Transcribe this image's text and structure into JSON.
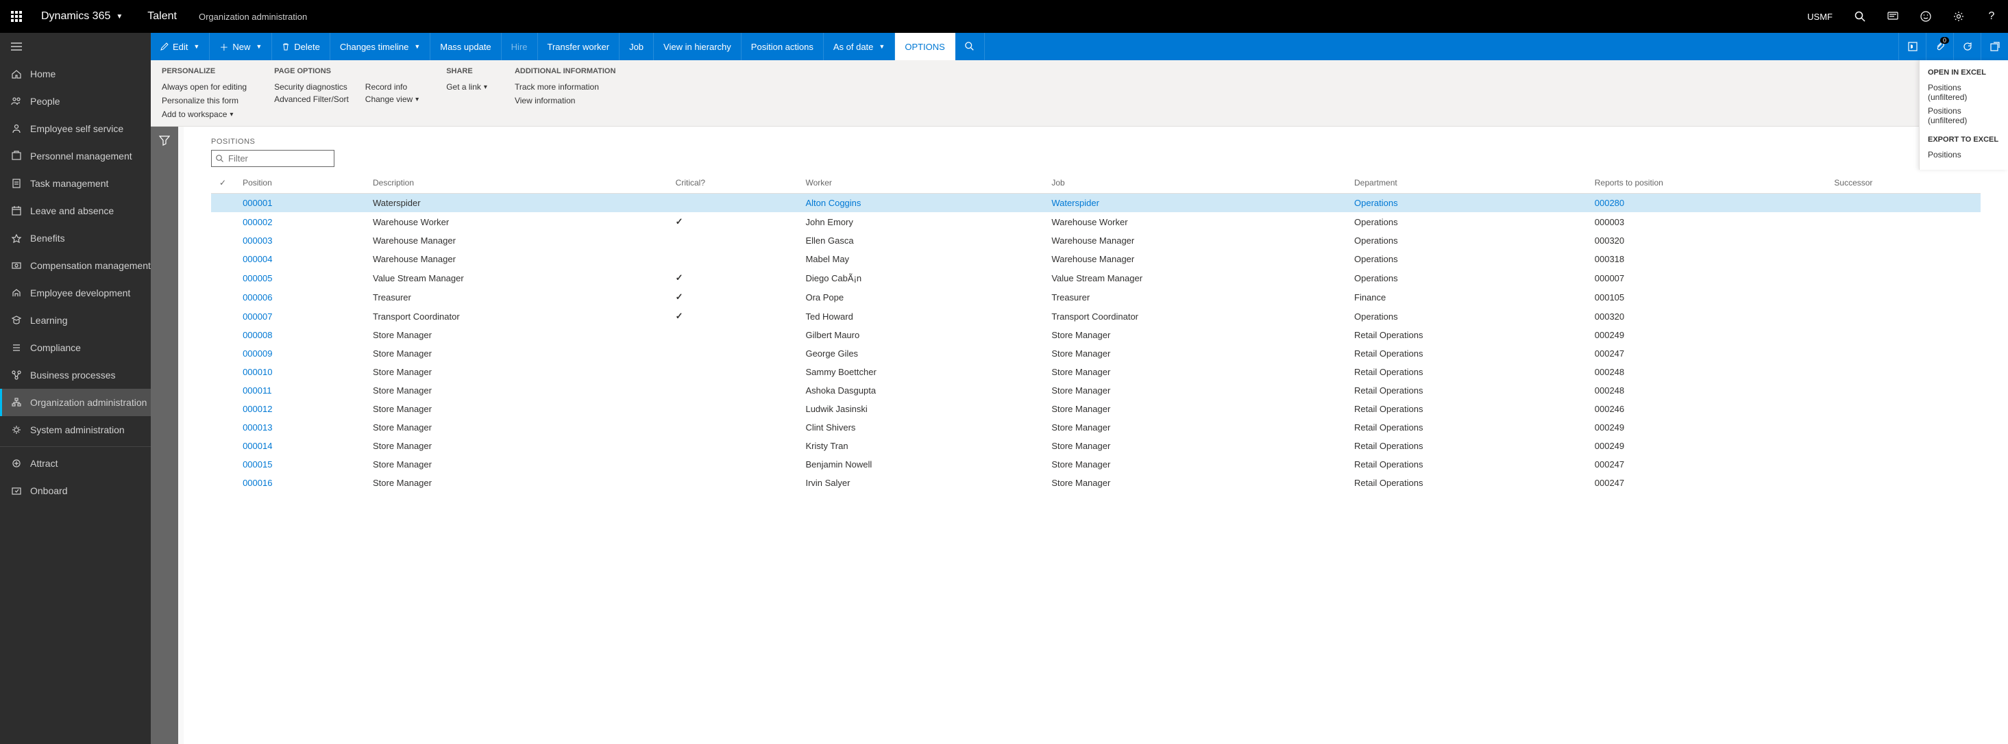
{
  "header": {
    "brand": "Dynamics 365",
    "app": "Talent",
    "breadcrumb": "Organization administration",
    "company": "USMF"
  },
  "nav": {
    "items": [
      {
        "icon": "home",
        "label": "Home"
      },
      {
        "icon": "people",
        "label": "People"
      },
      {
        "icon": "ess",
        "label": "Employee self service"
      },
      {
        "icon": "pm",
        "label": "Personnel management"
      },
      {
        "icon": "task",
        "label": "Task management"
      },
      {
        "icon": "leave",
        "label": "Leave and absence"
      },
      {
        "icon": "benefits",
        "label": "Benefits"
      },
      {
        "icon": "comp",
        "label": "Compensation management"
      },
      {
        "icon": "dev",
        "label": "Employee development"
      },
      {
        "icon": "learn",
        "label": "Learning"
      },
      {
        "icon": "compl",
        "label": "Compliance"
      },
      {
        "icon": "biz",
        "label": "Business processes"
      },
      {
        "icon": "org",
        "label": "Organization administration",
        "active": true
      },
      {
        "icon": "sys",
        "label": "System administration"
      }
    ],
    "items2": [
      {
        "icon": "attract",
        "label": "Attract"
      },
      {
        "icon": "onboard",
        "label": "Onboard"
      }
    ]
  },
  "cmdbar": {
    "edit": "Edit",
    "new": "New",
    "delete": "Delete",
    "timeline": "Changes timeline",
    "mass": "Mass update",
    "hire": "Hire",
    "transfer": "Transfer worker",
    "job": "Job",
    "hierarchy": "View in hierarchy",
    "posactions": "Position actions",
    "asof": "As of date",
    "options": "OPTIONS",
    "notif_count": "0"
  },
  "ribbon": {
    "personalize": {
      "title": "PERSONALIZE",
      "always_open": "Always open for editing",
      "personalize_form": "Personalize this form",
      "add_workspace": "Add to workspace"
    },
    "page_options": {
      "title": "PAGE OPTIONS",
      "security": "Security diagnostics",
      "filtersort": "Advanced Filter/Sort",
      "recordinfo": "Record info",
      "changeview": "Change view"
    },
    "share": {
      "title": "SHARE",
      "getlink": "Get a link"
    },
    "additional": {
      "title": "ADDITIONAL INFORMATION",
      "trackmore": "Track more information",
      "viewinfo": "View information"
    }
  },
  "grid": {
    "title": "POSITIONS",
    "filter_placeholder": "Filter",
    "columns": {
      "position": "Position",
      "description": "Description",
      "critical": "Critical?",
      "worker": "Worker",
      "job": "Job",
      "department": "Department",
      "reports": "Reports to position",
      "successor": "Successor"
    },
    "rows": [
      {
        "position": "000001",
        "description": "Waterspider",
        "critical": false,
        "worker": "Alton Coggins",
        "job": "Waterspider",
        "department": "Operations",
        "reports": "000280",
        "selected": true
      },
      {
        "position": "000002",
        "description": "Warehouse Worker",
        "critical": true,
        "worker": "John Emory",
        "job": "Warehouse Worker",
        "department": "Operations",
        "reports": "000003"
      },
      {
        "position": "000003",
        "description": "Warehouse Manager",
        "critical": false,
        "worker": "Ellen Gasca",
        "job": "Warehouse Manager",
        "department": "Operations",
        "reports": "000320"
      },
      {
        "position": "000004",
        "description": "Warehouse Manager",
        "critical": false,
        "worker": "Mabel May",
        "job": "Warehouse Manager",
        "department": "Operations",
        "reports": "000318"
      },
      {
        "position": "000005",
        "description": "Value Stream Manager",
        "critical": true,
        "worker": "Diego CabÃ¡n",
        "job": "Value Stream Manager",
        "department": "Operations",
        "reports": "000007"
      },
      {
        "position": "000006",
        "description": "Treasurer",
        "critical": true,
        "worker": "Ora Pope",
        "job": "Treasurer",
        "department": "Finance",
        "reports": "000105"
      },
      {
        "position": "000007",
        "description": "Transport Coordinator",
        "critical": true,
        "worker": "Ted Howard",
        "job": "Transport Coordinator",
        "department": "Operations",
        "reports": "000320"
      },
      {
        "position": "000008",
        "description": "Store Manager",
        "critical": false,
        "worker": "Gilbert Mauro",
        "job": "Store Manager",
        "department": "Retail Operations",
        "reports": "000249"
      },
      {
        "position": "000009",
        "description": "Store Manager",
        "critical": false,
        "worker": "George Giles",
        "job": "Store Manager",
        "department": "Retail Operations",
        "reports": "000247"
      },
      {
        "position": "000010",
        "description": "Store Manager",
        "critical": false,
        "worker": "Sammy Boettcher",
        "job": "Store Manager",
        "department": "Retail Operations",
        "reports": "000248"
      },
      {
        "position": "000011",
        "description": "Store Manager",
        "critical": false,
        "worker": "Ashoka Dasgupta",
        "job": "Store Manager",
        "department": "Retail Operations",
        "reports": "000248"
      },
      {
        "position": "000012",
        "description": "Store Manager",
        "critical": false,
        "worker": "Ludwik Jasinski",
        "job": "Store Manager",
        "department": "Retail Operations",
        "reports": "000246"
      },
      {
        "position": "000013",
        "description": "Store Manager",
        "critical": false,
        "worker": "Clint Shivers",
        "job": "Store Manager",
        "department": "Retail Operations",
        "reports": "000249"
      },
      {
        "position": "000014",
        "description": "Store Manager",
        "critical": false,
        "worker": "Kristy Tran",
        "job": "Store Manager",
        "department": "Retail Operations",
        "reports": "000249"
      },
      {
        "position": "000015",
        "description": "Store Manager",
        "critical": false,
        "worker": "Benjamin Nowell",
        "job": "Store Manager",
        "department": "Retail Operations",
        "reports": "000247"
      },
      {
        "position": "000016",
        "description": "Store Manager",
        "critical": false,
        "worker": "Irvin Salyer",
        "job": "Store Manager",
        "department": "Retail Operations",
        "reports": "000247"
      }
    ]
  },
  "flyout": {
    "open_title": "OPEN IN EXCEL",
    "open_items": [
      "Positions (unfiltered)",
      "Positions (unfiltered)"
    ],
    "export_title": "EXPORT TO EXCEL",
    "export_items": [
      "Positions"
    ]
  }
}
